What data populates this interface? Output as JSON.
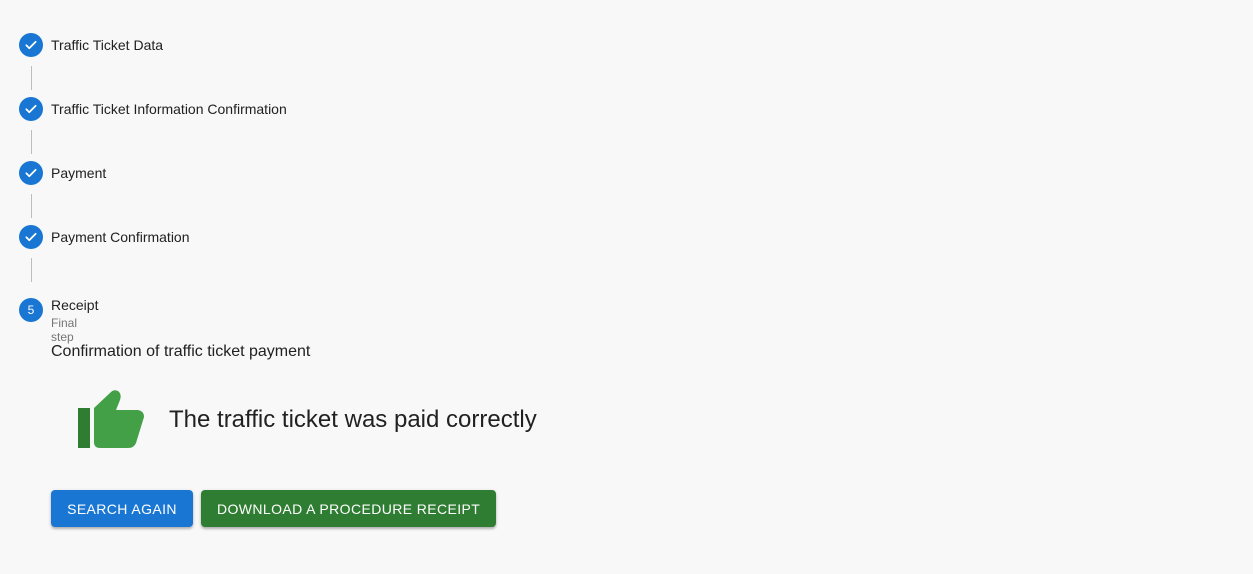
{
  "stepper": {
    "steps": [
      {
        "label": "Traffic Ticket Data",
        "status": "completed"
      },
      {
        "label": "Traffic Ticket Information Confirmation",
        "status": "completed"
      },
      {
        "label": "Payment",
        "status": "completed"
      },
      {
        "label": "Payment Confirmation",
        "status": "completed"
      },
      {
        "label": "Receipt",
        "status": "active",
        "number": "5",
        "caption": "Final step"
      }
    ],
    "completed_icon": "check-circle-icon"
  },
  "receipt": {
    "title": "Confirmation of traffic ticket payment",
    "success_icon": "thumb-up-icon",
    "success_message": "The traffic ticket was paid correctly"
  },
  "actions": {
    "search_again_label": "Search again",
    "download_receipt_label": "Download a procedure receipt"
  },
  "colors": {
    "primary": "#1976d2",
    "success": "#2e7d32",
    "thumb_light": "#43a047",
    "thumb_dark": "#2e7d32",
    "background": "#f8f8f8"
  }
}
